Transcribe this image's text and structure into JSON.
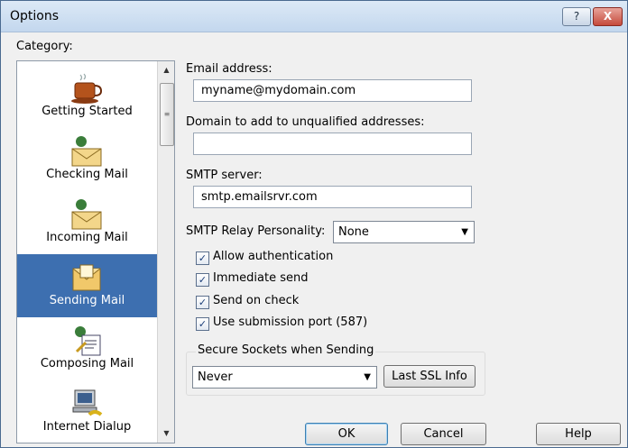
{
  "window": {
    "title": "Options",
    "help_glyph": "?",
    "close_glyph": "X"
  },
  "category": {
    "label": "Category:",
    "items": [
      {
        "label": "Getting Started",
        "icon": "coffee-cup-icon",
        "selected": false
      },
      {
        "label": "Checking Mail",
        "icon": "envelope-person-icon",
        "selected": false
      },
      {
        "label": "Incoming Mail",
        "icon": "envelope-person-icon",
        "selected": false
      },
      {
        "label": "Sending Mail",
        "icon": "open-envelope-icon",
        "selected": true
      },
      {
        "label": "Composing Mail",
        "icon": "compose-document-icon",
        "selected": false
      },
      {
        "label": "Internet Dialup",
        "icon": "computer-phone-icon",
        "selected": false
      }
    ]
  },
  "form": {
    "email_label": "Email address:",
    "email_value": "myname@mydomain.com",
    "domain_label": "Domain to add to unqualified addresses:",
    "domain_value": "",
    "smtp_label": "SMTP server:",
    "smtp_value": "smtp.emailsrvr.com",
    "relay_label": "SMTP Relay Personality:",
    "relay_value": "None",
    "checkboxes": [
      {
        "label": "Allow authentication",
        "checked": true
      },
      {
        "label": "Immediate send",
        "checked": true
      },
      {
        "label": "Send on check",
        "checked": true
      },
      {
        "label": "Use submission port (587)",
        "checked": true
      }
    ],
    "ssl_group_title": "Secure Sockets when Sending",
    "ssl_value": "Never",
    "ssl_info_button": "Last SSL Info"
  },
  "buttons": {
    "ok": "OK",
    "cancel": "Cancel",
    "help": "Help"
  },
  "colors": {
    "selection": "#3d6fb0",
    "title_gradient_top": "#dce9f6",
    "close_red": "#c54a3b"
  }
}
